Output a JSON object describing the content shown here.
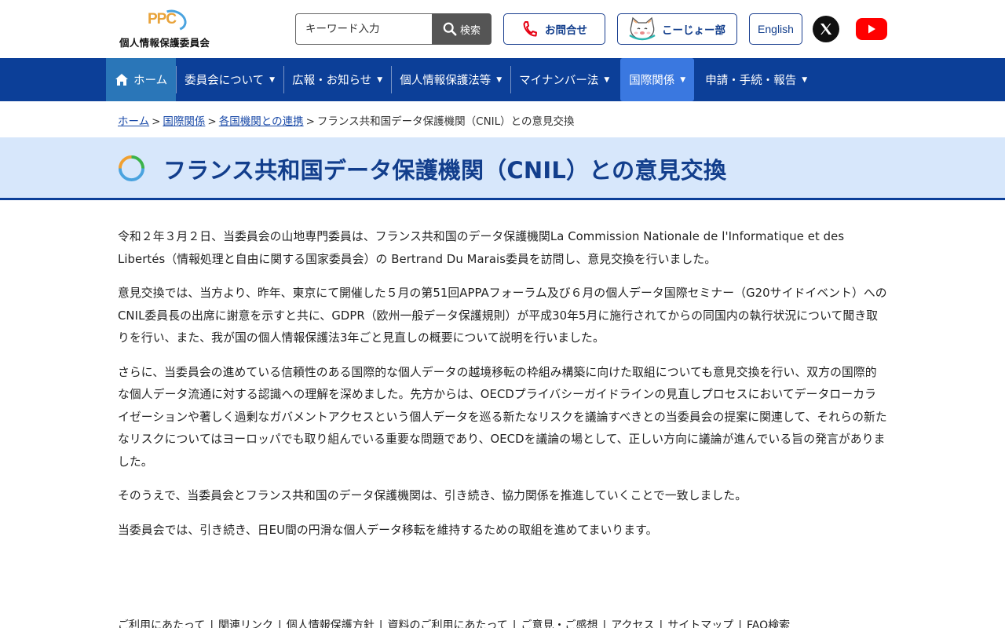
{
  "header": {
    "logo_mark": "PPC",
    "logo_text": "個人情報保護委員会",
    "search": {
      "placeholder": "キーワード入力",
      "button_label": "検索"
    },
    "contact_label": "お問合せ",
    "kojo_label": "こーじょー部",
    "english_label": "English"
  },
  "nav": {
    "items": [
      {
        "label": "ホーム"
      },
      {
        "label": "委員会について"
      },
      {
        "label": "広報・お知らせ"
      },
      {
        "label": "個人情報保護法等"
      },
      {
        "label": "マイナンバー法"
      },
      {
        "label": "国際関係"
      },
      {
        "label": "申請・手続・報告"
      }
    ]
  },
  "breadcrumb": {
    "items": [
      "ホーム",
      "国際関係",
      "各国機関との連携"
    ],
    "current": "フランス共和国データ保護機関（CNIL）との意見交換"
  },
  "page": {
    "title": "フランス共和国データ保護機関（CNIL）との意見交換",
    "paragraphs": [
      "令和２年３月２日、当委員会の山地専門委員は、フランス共和国のデータ保護機関La Commission Nationale de l'Informatique et des Libertés（情報処理と自由に関する国家委員会）の Bertrand Du Marais委員を訪問し、意見交換を行いました。",
      "意見交換では、当方より、昨年、東京にて開催した５月の第51回APPAフォーラム及び６月の個人データ国際セミナー（G20サイドイベント）へのCNIL委員長の出席に謝意を示すと共に、GDPR（欧州一般データ保護規則）が平成30年5月に施行されてからの同国内の執行状況について聞き取りを行い、また、我が国の個人情報保護法3年ごと見直しの概要について説明を行いました。",
      "さらに、当委員会の進めている信頼性のある国際的な個人データの越境移転の枠組み構築に向けた取組についても意見交換を行い、双方の国際的な個人データ流通に対する認識への理解を深めました。先方からは、OECDプライバシーガイドラインの見直しプロセスにおいてデータローカライゼーションや著しく過剰なガバメントアクセスという個人データを巡る新たなリスクを議論すべきとの当委員会の提案に関連して、それらの新たなリスクについてはヨーロッパでも取り組んでいる重要な問題であり、OECDを議論の場として、正しい方向に議論が進んでいる旨の発言がありました。",
      "そのうえで、当委員会とフランス共和国のデータ保護機関は、引き続き、協力関係を推進していくことで一致しました。",
      "当委員会では、引き続き、日EU間の円滑な個人データ移転を維持するための取組を進めてまいります。"
    ]
  },
  "footer": {
    "links": [
      "ご利用にあたって",
      "関連リンク",
      "個人情報保護方針",
      "資料のご利用にあたって",
      "ご意見・ご感想",
      "アクセス",
      "サイトマップ",
      "FAQ検索"
    ]
  },
  "colors": {
    "nav_bg": "#0c3f98",
    "home_bg": "#2a76b8",
    "active_bg": "#3a78e0",
    "title_band_bg": "#d7e7fb",
    "title_text": "#123e8c"
  }
}
